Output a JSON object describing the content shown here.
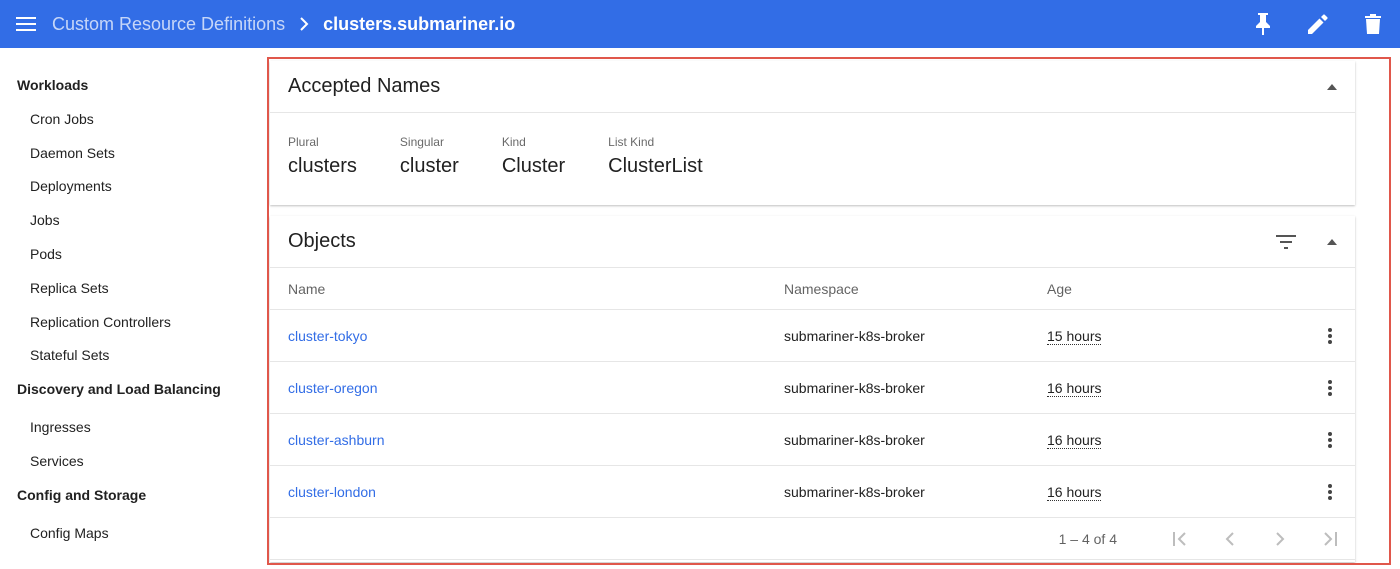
{
  "toolbar": {
    "menu_icon": "menu-icon",
    "breadcrumb_parent": "Custom Resource Definitions",
    "breadcrumb_current": "clusters.submariner.io",
    "actions": [
      "pin-icon",
      "edit-icon",
      "delete-icon"
    ],
    "color": "#326de6"
  },
  "sidebar": {
    "sections": [
      {
        "title": "Workloads",
        "items": [
          "Cron Jobs",
          "Daemon Sets",
          "Deployments",
          "Jobs",
          "Pods",
          "Replica Sets",
          "Replication Controllers",
          "Stateful Sets"
        ]
      },
      {
        "title": "Discovery and Load Balancing",
        "items": [
          "Ingresses",
          "Services"
        ]
      },
      {
        "title": "Config and Storage",
        "items": [
          "Config Maps"
        ]
      }
    ]
  },
  "accepted_names": {
    "title": "Accepted Names",
    "fields": [
      {
        "label": "Plural",
        "value": "clusters"
      },
      {
        "label": "Singular",
        "value": "cluster"
      },
      {
        "label": "Kind",
        "value": "Cluster"
      },
      {
        "label": "List Kind",
        "value": "ClusterList"
      }
    ]
  },
  "objects": {
    "title": "Objects",
    "columns": [
      "Name",
      "Namespace",
      "Age"
    ],
    "rows": [
      {
        "name": "cluster-tokyo",
        "namespace": "submariner-k8s-broker",
        "age": "15 hours"
      },
      {
        "name": "cluster-oregon",
        "namespace": "submariner-k8s-broker",
        "age": "16 hours"
      },
      {
        "name": "cluster-ashburn",
        "namespace": "submariner-k8s-broker",
        "age": "16 hours"
      },
      {
        "name": "cluster-london",
        "namespace": "submariner-k8s-broker",
        "age": "16 hours"
      }
    ],
    "pagination": "1 – 4 of 4"
  },
  "colors": {
    "accent": "#326de6",
    "highlight_border": "#e0574b"
  }
}
